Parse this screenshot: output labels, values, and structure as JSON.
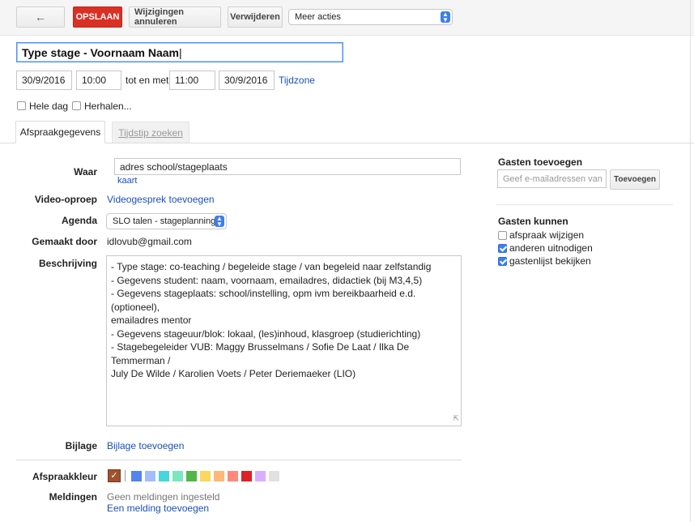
{
  "toolbar": {
    "back_icon": "arrow-left-icon",
    "save_label": "OPSLAAN",
    "discard_label": "Wijzigingen annuleren",
    "delete_label": "Verwijderen",
    "more_actions": "Meer acties"
  },
  "event": {
    "title": "Type stage - Voornaam Naam",
    "start_date": "30/9/2016",
    "start_time": "10:00",
    "until_label": "tot en met",
    "end_time": "11:00",
    "end_date": "30/9/2016",
    "timezone_link": "Tijdzone",
    "all_day_label": "Hele dag",
    "repeat_label": "Herhalen..."
  },
  "tabs": [
    {
      "label": "Afspraakgegevens",
      "active": true
    },
    {
      "label": "Tijdstip zoeken",
      "active": false
    }
  ],
  "details": {
    "where_label": "Waar",
    "where_value": "adres school/stageplaats",
    "map_link": "kaart",
    "video_label": "Video-oproep",
    "video_link": "Videogesprek toevoegen",
    "calendar_label": "Agenda",
    "calendar_value": "SLO talen - stageplanning",
    "created_by_label": "Gemaakt door",
    "created_by_value": "idlovub@gmail.com",
    "description_label": "Beschrijving",
    "description_lines": [
      "- Type stage:  co-teaching / begeleide stage / van begeleid naar zelfstandig",
      "- Gegevens student: naam, voornaam, emailadres, didactiek (bij M3,4,5)",
      "- Gegevens stageplaats: school/instelling, opm ivm bereikbaarheid e.d. (optioneel),",
      "emailadres mentor",
      "- Gegevens stageuur/blok: lokaal, (les)inhoud, klasgroep (studierichting)",
      "- Stagebegeleider VUB: Maggy Brusselmans / Sofie De Laat / Ilka De Temmerman /",
      "July De Wilde / Karolien Voets / Peter Deriemaeker (LIO)"
    ],
    "attachment_label": "Bijlage",
    "attachment_link": "Bijlage toevoegen",
    "color_label": "Afspraakkleur",
    "colors": [
      "#a0522d",
      "#5484ed",
      "#a4bdfc",
      "#46d6db",
      "#7ae7bf",
      "#51b749",
      "#fbd75b",
      "#ffb878",
      "#ff887c",
      "#dc2127",
      "#dbadff",
      "#e1e1e1"
    ],
    "notifications_label": "Meldingen",
    "notifications_none": "Geen meldingen ingesteld",
    "notifications_add": "Een melding toevoegen"
  },
  "guests": {
    "title": "Gasten toevoegen",
    "input_placeholder": "Geef e-mailadressen van",
    "add_button": "Toevoegen",
    "can_title": "Gasten kunnen",
    "options": [
      {
        "label": "afspraak wijzigen",
        "checked": false
      },
      {
        "label": "anderen uitnodigen",
        "checked": true
      },
      {
        "label": "gastenlijst bekijken",
        "checked": true
      }
    ]
  }
}
